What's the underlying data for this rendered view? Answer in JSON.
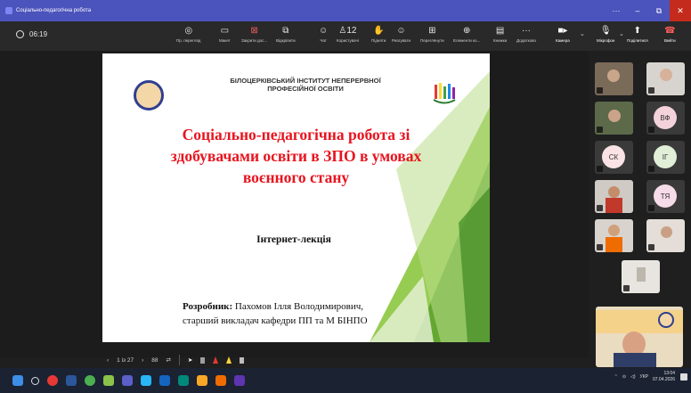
{
  "window": {
    "title": "Соціально-педагогічна робота",
    "controls": [
      "···",
      "–",
      "⧉",
      "✕"
    ]
  },
  "meeting": {
    "timer": "06:19"
  },
  "toolbar": {
    "stage": [
      {
        "icon": "broadcast-icon",
        "glyph": "◎",
        "label": "Пр. перегляд"
      },
      {
        "icon": "layout-icon",
        "glyph": "▭",
        "label": "Макет"
      },
      {
        "icon": "stop-share-icon",
        "glyph": "⊠",
        "label": "Закрити дос..."
      },
      {
        "icon": "popout-icon",
        "glyph": "⧉",
        "label": "Відкріпити"
      }
    ],
    "actions": [
      {
        "icon": "chat-icon",
        "glyph": "☺",
        "label": "Чат"
      },
      {
        "icon": "people-icon",
        "glyph": "♙12",
        "label": "Користувачі"
      },
      {
        "icon": "raise-hand-icon",
        "glyph": "✋",
        "label": "Підняти"
      },
      {
        "icon": "react-icon",
        "glyph": "☺",
        "label": "Реагувати"
      },
      {
        "icon": "rooms-icon",
        "glyph": "⊞",
        "label": "Переглянути"
      },
      {
        "icon": "apps-icon",
        "glyph": "⊕",
        "label": "Елементи ко..."
      },
      {
        "icon": "notes-icon",
        "glyph": "▤",
        "label": "Книжки"
      },
      {
        "icon": "more-icon",
        "glyph": "···",
        "label": "Додатково"
      }
    ],
    "camera_label": "Камера",
    "mic_label": "Мікрофон",
    "share_label": "Поділитися",
    "leave_label": "Вийти"
  },
  "slide": {
    "institution_line1": "БІЛОЦЕРКІВСЬКИЙ ІНСТИТУТ НЕПЕРЕРВНОЇ",
    "institution_line2": "ПРОФЕСІЙНОЇ ОСВІТИ",
    "title_line1": "Соціально-педагогічна робота зі",
    "title_line2": "здобувачами освіти в ЗПО в умовах",
    "title_line3": "воєнного стану",
    "subtitle": "Інтернет-лекція",
    "author_label": "Розробник:",
    "author_name": " Пахомов Ілля Володимирович,",
    "author_position": "старший викладач кафедри ПП та М БІНПО"
  },
  "slide_nav": {
    "prev": "‹",
    "counter": "1 із 27",
    "next": "›",
    "grid": "88",
    "settings": "⇄"
  },
  "participants": [
    {
      "initials": "ВФ",
      "avatar_color": "#f3d2dc"
    },
    {
      "initials": "СК",
      "avatar_color": "#fbe3e5"
    },
    {
      "initials": "ІГ",
      "avatar_color": "#e1efd8"
    },
    {
      "initials": "ТЯ",
      "avatar_color": "#f6dbe8"
    }
  ],
  "colors": {
    "accent": "#4b53bc",
    "slide_title": "#e8141f",
    "leave": "#c42b1c"
  },
  "tray": {
    "lang": "УКР",
    "time": "13:04",
    "date": "07.04.2026"
  }
}
